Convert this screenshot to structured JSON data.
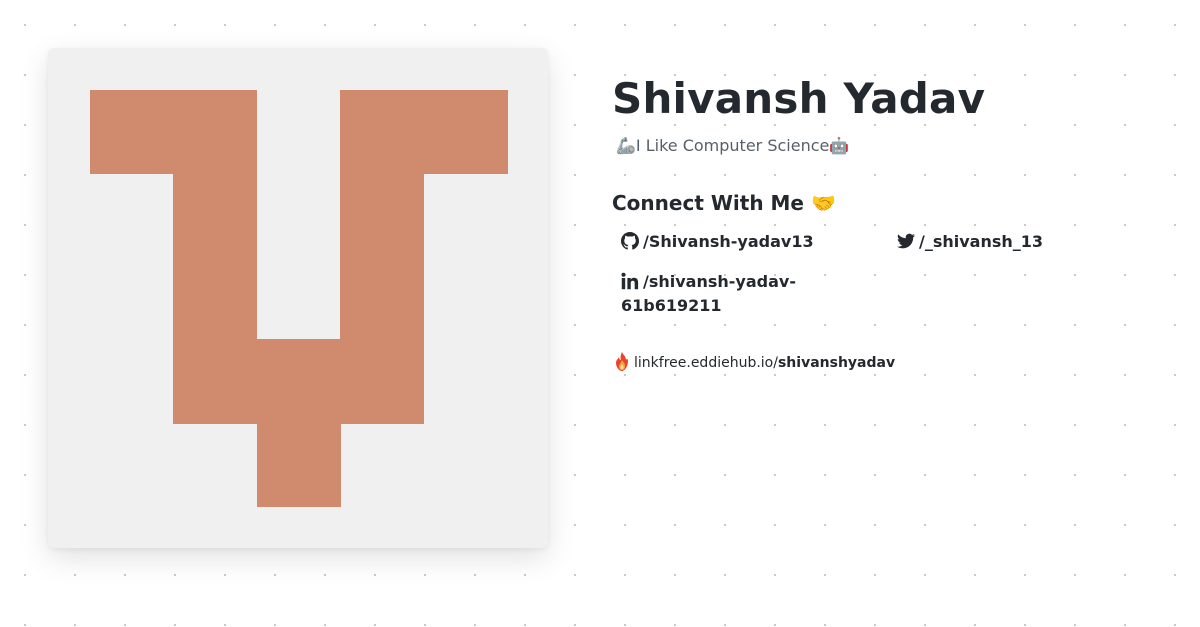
{
  "avatar": {
    "monogram_color": "#d08a6e",
    "background_color": "#f0f0f0"
  },
  "profile": {
    "name": "Shivansh Yadav",
    "bio_prefix_emoji": "🦾",
    "bio": "I Like Computer Science",
    "bio_suffix_emoji": "🤖"
  },
  "connect": {
    "heading": "Connect With Me",
    "heading_emoji": "🤝"
  },
  "socials": {
    "github": {
      "icon": "github-icon",
      "label": "/Shivansh-yadav13"
    },
    "twitter": {
      "icon": "twitter-icon",
      "label": "/_shivansh_13"
    },
    "linkedin": {
      "icon": "linkedin-icon",
      "label": "/shivansh-yadav-61b619211"
    }
  },
  "linkfree": {
    "icon": "linkfree-flame-icon",
    "domain": "linkfree.eddiehub.io/",
    "handle": "shivanshyadav"
  }
}
